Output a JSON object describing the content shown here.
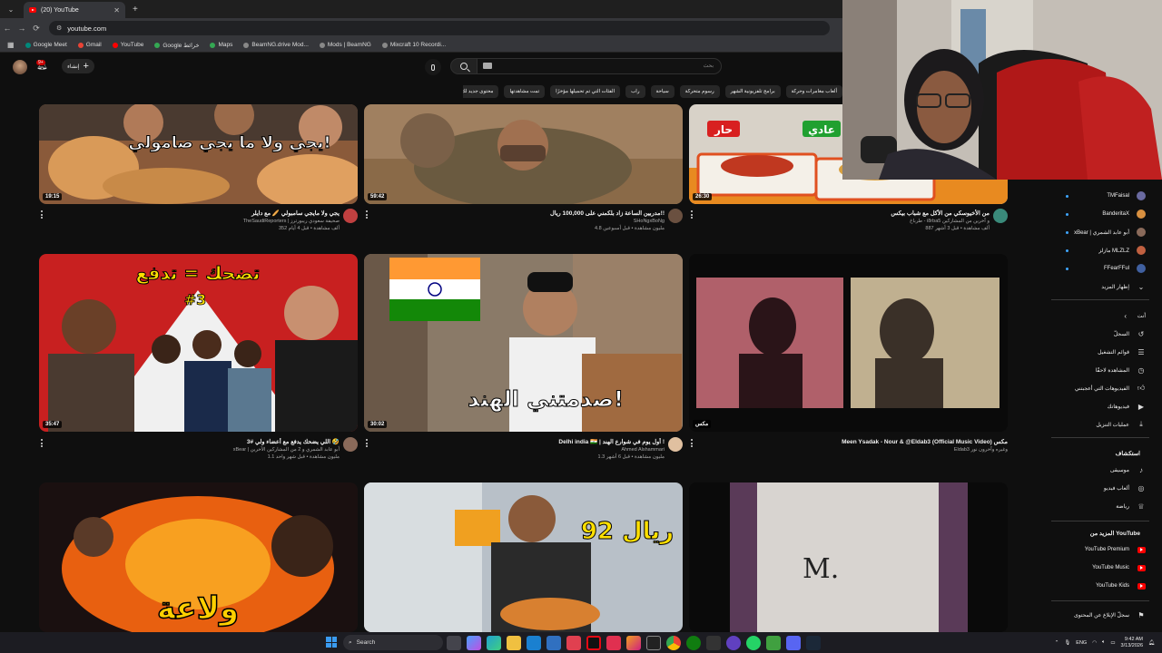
{
  "browser": {
    "tab_title": "(20) YouTube",
    "url": "youtube.com",
    "bookmarks": [
      "Google Meet",
      "Gmail",
      "YouTube",
      "Google خرائط",
      "Maps",
      "BeamNG.drive Mod...",
      "Mods | BeamNG",
      "Mixcraft 10 Recordi..."
    ]
  },
  "header": {
    "create_label": "إنشاء",
    "notification_count": "9+",
    "search_placeholder": "بحث"
  },
  "chips": [
    "ألعاب مغامرات وحركة",
    "برامج تلفزيونية الشهر",
    "رسوم متحركة",
    "سياحة",
    "راب",
    "الفئات التي تم تحميلها مؤخرًا",
    "تمت مشاهدتها",
    "محتوى جديد لك"
  ],
  "videos": [
    {
      "title": "يجي ولا مايجي سامبولي 🥖 مع دايلر",
      "channel": "TheSaudiReporters | صحيفة سعودي ريبورترز",
      "stats": "352 ألف مشاهدة • قبل 4 أيام",
      "duration": "19:15"
    },
    {
      "title": "مدربين الساعة زاد بلكمني على 100,000 ريال!!",
      "channel": "SHoNgxBoNg",
      "stats": "4.8 مليون مشاهدة • قبل أسبوعين",
      "duration": "59:42"
    },
    {
      "title": "من الأخيوسكي من الأكل مع شباب بيكس",
      "channel": "طرباخ - i8rba5 و آخرين من المشاركين",
      "stats": "887 ألف مشاهدة • قبل 3 أشهر",
      "duration": "26:30"
    },
    {
      "title": "اللي يضحك يدفع مع أعضاء ولي #3 🤣",
      "channel": "xBear | أبو عابد الشمري و 2 من المشاركين الآخرين",
      "stats": "1.1 مليون مشاهدة • قبل شهر واحد",
      "duration": "35:47"
    },
    {
      "title": "Delhi india 🇮🇳 | أول يوم في شوارع الهند !",
      "channel": "Ahmed Alshammari",
      "stats": "1.3 مليون مشاهدة • قبل 6 أشهر",
      "duration": "30:02"
    },
    {
      "title": "Meen Ysadak - Nour & @Eldab3 (Official Music Video) مكس",
      "channel": "Eldab3 وغيره وآخرون نور",
      "stats": "",
      "duration": "مكس"
    },
    {
      "title": "",
      "channel": "",
      "stats": "",
      "duration": ""
    },
    {
      "title": "",
      "channel": "",
      "stats": "",
      "duration": ""
    },
    {
      "title": "",
      "channel": "",
      "stats": "",
      "duration": ""
    }
  ],
  "thumb_text": {
    "v1": "يجي ولا ما يجي صامولي!",
    "v3a": "حار",
    "v3b": "عادي",
    "v4": "تضحك = تدفع",
    "v4b": "#3",
    "v5": "صدمتني الهند!",
    "v8": "92 ريال",
    "v7": "ولاعة",
    "v9": "M."
  },
  "guide": {
    "subscriptions": [
      "TMFaisal",
      "BanderitaX",
      "xBear | أبو عابد الشمري",
      "مازلز MLZLZ",
      "FFearFFul"
    ],
    "show_more": "إظهار المزيد",
    "you_heading": "أنت",
    "you_items": [
      "السجلّ",
      "قوائم التشغيل",
      "المشاهدة لاحقًا",
      "الفيديوهات التي أعجبتني",
      "فيديوهاتك",
      "عمليات التنزيل"
    ],
    "explore_heading": "استكشاف",
    "explore_items": [
      "موسيقى",
      "ألعاب فيديو",
      "رياضة"
    ],
    "more_heading": "المزيد من YouTube",
    "more_items": [
      "YouTube Premium",
      "YouTube Music",
      "YouTube Kids"
    ],
    "report": "سجلّ الإبلاغ عن المحتوى"
  },
  "taskbar": {
    "search_label": "Search",
    "lang": "ENG",
    "time": "9:42 AM",
    "date": "3/13/2026"
  },
  "colors": {
    "accent": "#ff0000",
    "bg": "#0f0f0f"
  }
}
